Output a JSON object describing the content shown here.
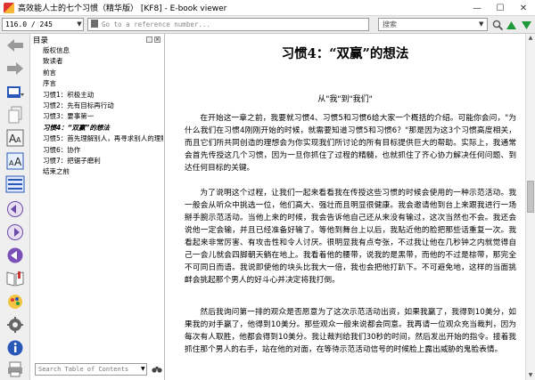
{
  "window": {
    "title": "高效能人士的七个习惯（精华版） [KF8] - E-book viewer",
    "buttons": {
      "minimize": "—",
      "maximize": "☐",
      "close": "✕"
    }
  },
  "toolbar": {
    "page_position": "116.0 / 245",
    "reference_placeholder": "Go to a reference number...",
    "search_placeholder": "搜索",
    "dropdown_glyph": "▼"
  },
  "toc": {
    "header": "目录",
    "items": [
      "版权信息",
      "致读者",
      "前言",
      "序言",
      "习惯1：积极主动",
      "习惯2：先有目标再行动",
      "习惯3：要事第一",
      "习惯4：“双赢”的想法",
      "习惯5：首先理解别人，再寻求别人的理解",
      "习惯6：协作",
      "习惯7：把锯子磨利",
      "结束之前"
    ],
    "active_index": 7,
    "search_placeholder": "Search Table of Contents"
  },
  "document": {
    "title": "习惯4：“双赢”的想法",
    "subtitle": "从\"我\"到\"我们\"",
    "paragraphs": [
      "在开始这一章之前，我要就习惯4、习惯5和习惯6给大家一个概括的介绍。可能你会问，\"为什么我们在习惯4刚刚开始的时候，就需要知道习惯5和习惯6？\"那是因为这3个习惯高度相关，而且它们所共同创造的理想会为你实现我们所讨论的所有目标提供巨大的帮助。实际上，我通常会首先传授这几个习惯，因为一旦你抓住了过程的精髓，也就抓住了齐心协力解决任何问题、到达任何目标的关键。",
      "为了说明这个过程，让我们一起来看看我在传授这些习惯的时候会使用的一种示范活动。我一般会从听众中挑选一位，他们高大、强壮而且明显很健康。我会邀请他到台上来跟我进行一场掰手腕示范活动。当他上来的时候，我会告诉他自己还从来没有输过，这次当然也不会。我还会说他一定会输，并且已经准备好输了。等他到舞台上以后，我贴近他的脸把那些话重复一次。我看起来非常厉害、有攻击性和令人讨厌。很明显我有点夸张，不过我让他在几秒钟之内就觉得自己一会儿就会四脚朝天躺在地上。我看着他的腰带，说我的是黑带，而他的不过是棕带，那完全不可同日而语。我说即使他的块头比我大一倍，我也会把他打趴下。不可避免地，这样的当面挑衅会挑起那个男人的好斗心并决定将我打倒。",
      "然后我询问第一排的观众是否愿意为了这次示范活动出资，如果我赢了，我得到10美分，如果我的对手赢了，他得到10美分。那些观众一般来说都会同意。我再请一位观众充当裁判，因为每次有人取胜，他都会得到10美分。我让裁判给我们30秒的时间，然后发出开始的指令。接着我抓住那个男人的右手，站在他的对面，在等待示范活动信号的时候脸上露出威胁的鬼脸表情。"
    ]
  },
  "colors": {
    "tb_green": "#1e9a3a",
    "icon_blue": "#2a58b8",
    "icon_gray": "#8a8a8a"
  }
}
